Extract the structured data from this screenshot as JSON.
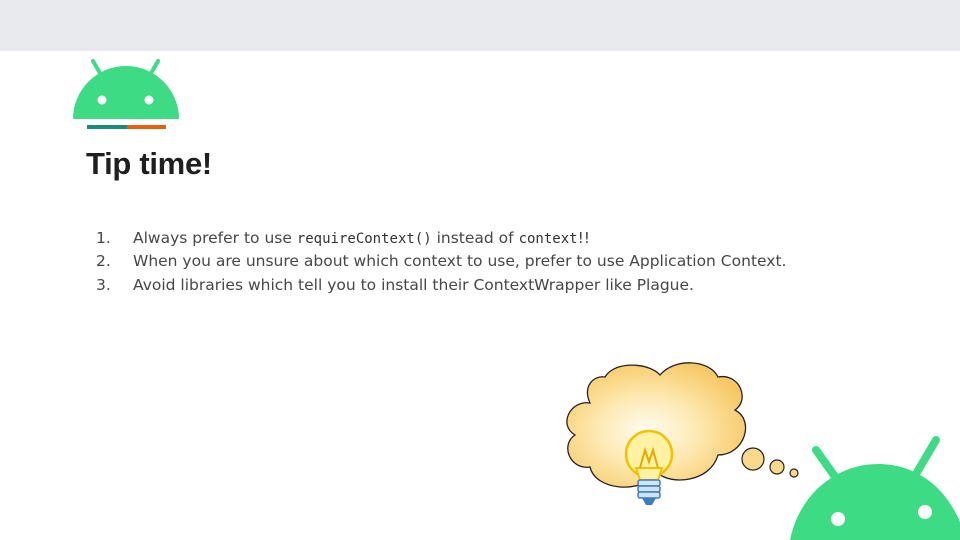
{
  "slide": {
    "title": "Tip time!",
    "tips": [
      {
        "number": "1.",
        "parts": [
          {
            "text": "Always prefer to use ",
            "code": false
          },
          {
            "text": "requireContext()",
            "code": true
          },
          {
            "text": " instead of ",
            "code": false
          },
          {
            "text": "context",
            "code": true
          },
          {
            "text": "!!",
            "code": false
          }
        ]
      },
      {
        "number": "2.",
        "parts": [
          {
            "text": "When you are unsure about which context to use, prefer to use Application Context.",
            "code": false
          }
        ]
      },
      {
        "number": "3.",
        "parts": [
          {
            "text": "Avoid libraries which tell you to install their ContextWrapper like Plague.",
            "code": false
          }
        ]
      }
    ]
  },
  "colors": {
    "top_bar": "#e8eaed",
    "android_green": "#3ddc84",
    "accent_teal": "#1a8a7a",
    "accent_orange": "#e8600c",
    "thought_fill": "#fbd98a",
    "text": "#474747"
  },
  "icons": {
    "logo": "android-head-icon",
    "bubble": "thought-bubble-icon",
    "bulb": "light-bulb-icon",
    "corner": "android-head-icon"
  }
}
